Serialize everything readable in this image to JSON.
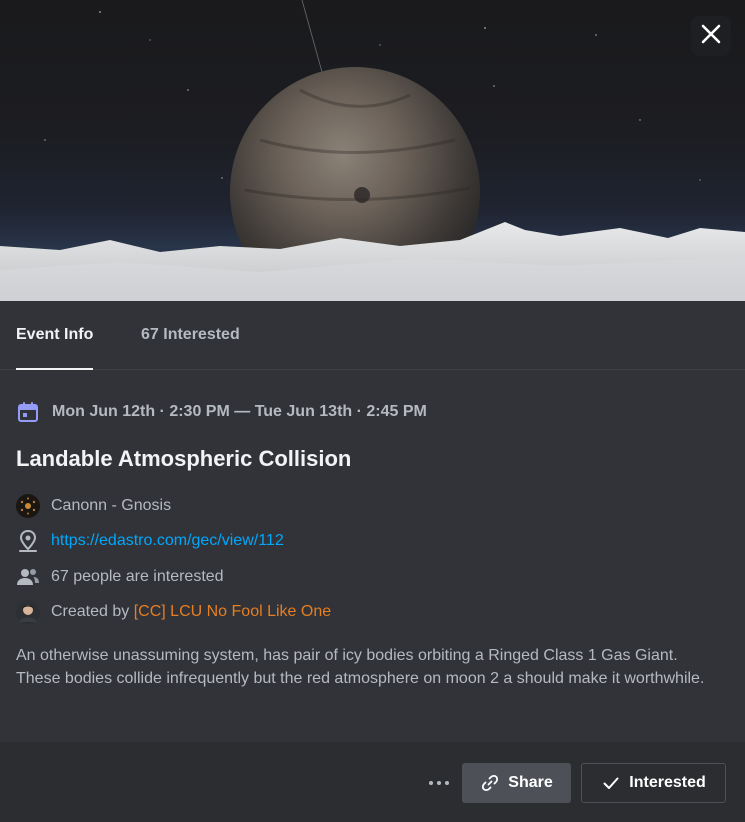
{
  "colors": {
    "background": "#313338",
    "footer": "#2b2d31",
    "link": "#00a8fc",
    "creator": "#e67e22",
    "accent": "#5865f2"
  },
  "tabs": [
    {
      "label": "Event Info",
      "active": true
    },
    {
      "label": "67 Interested",
      "active": false
    }
  ],
  "event": {
    "datetime": "Mon Jun 12th · 2:30 PM — Tue Jun 13th · 2:45 PM",
    "title": "Landable Atmospheric Collision",
    "server": "Canonn - Gnosis",
    "location_url": "https://edastro.com/gec/view/112",
    "interested_text": "67 people are interested",
    "created_by_prefix": "Created by",
    "creator": "[CC] LCU No Fool Like One",
    "description": "An otherwise unassuming system, has pair of icy bodies orbiting a Ringed Class 1 Gas Giant. These bodies collide infrequently but the red atmosphere on moon 2 a should make it worthwhile."
  },
  "footer": {
    "share_label": "Share",
    "interested_label": "Interested"
  },
  "icons": {
    "close": "close-icon",
    "calendar": "calendar-icon",
    "location": "location-pin-icon",
    "people": "people-icon",
    "more": "more-dots-icon",
    "share": "link-icon",
    "check": "check-icon"
  }
}
